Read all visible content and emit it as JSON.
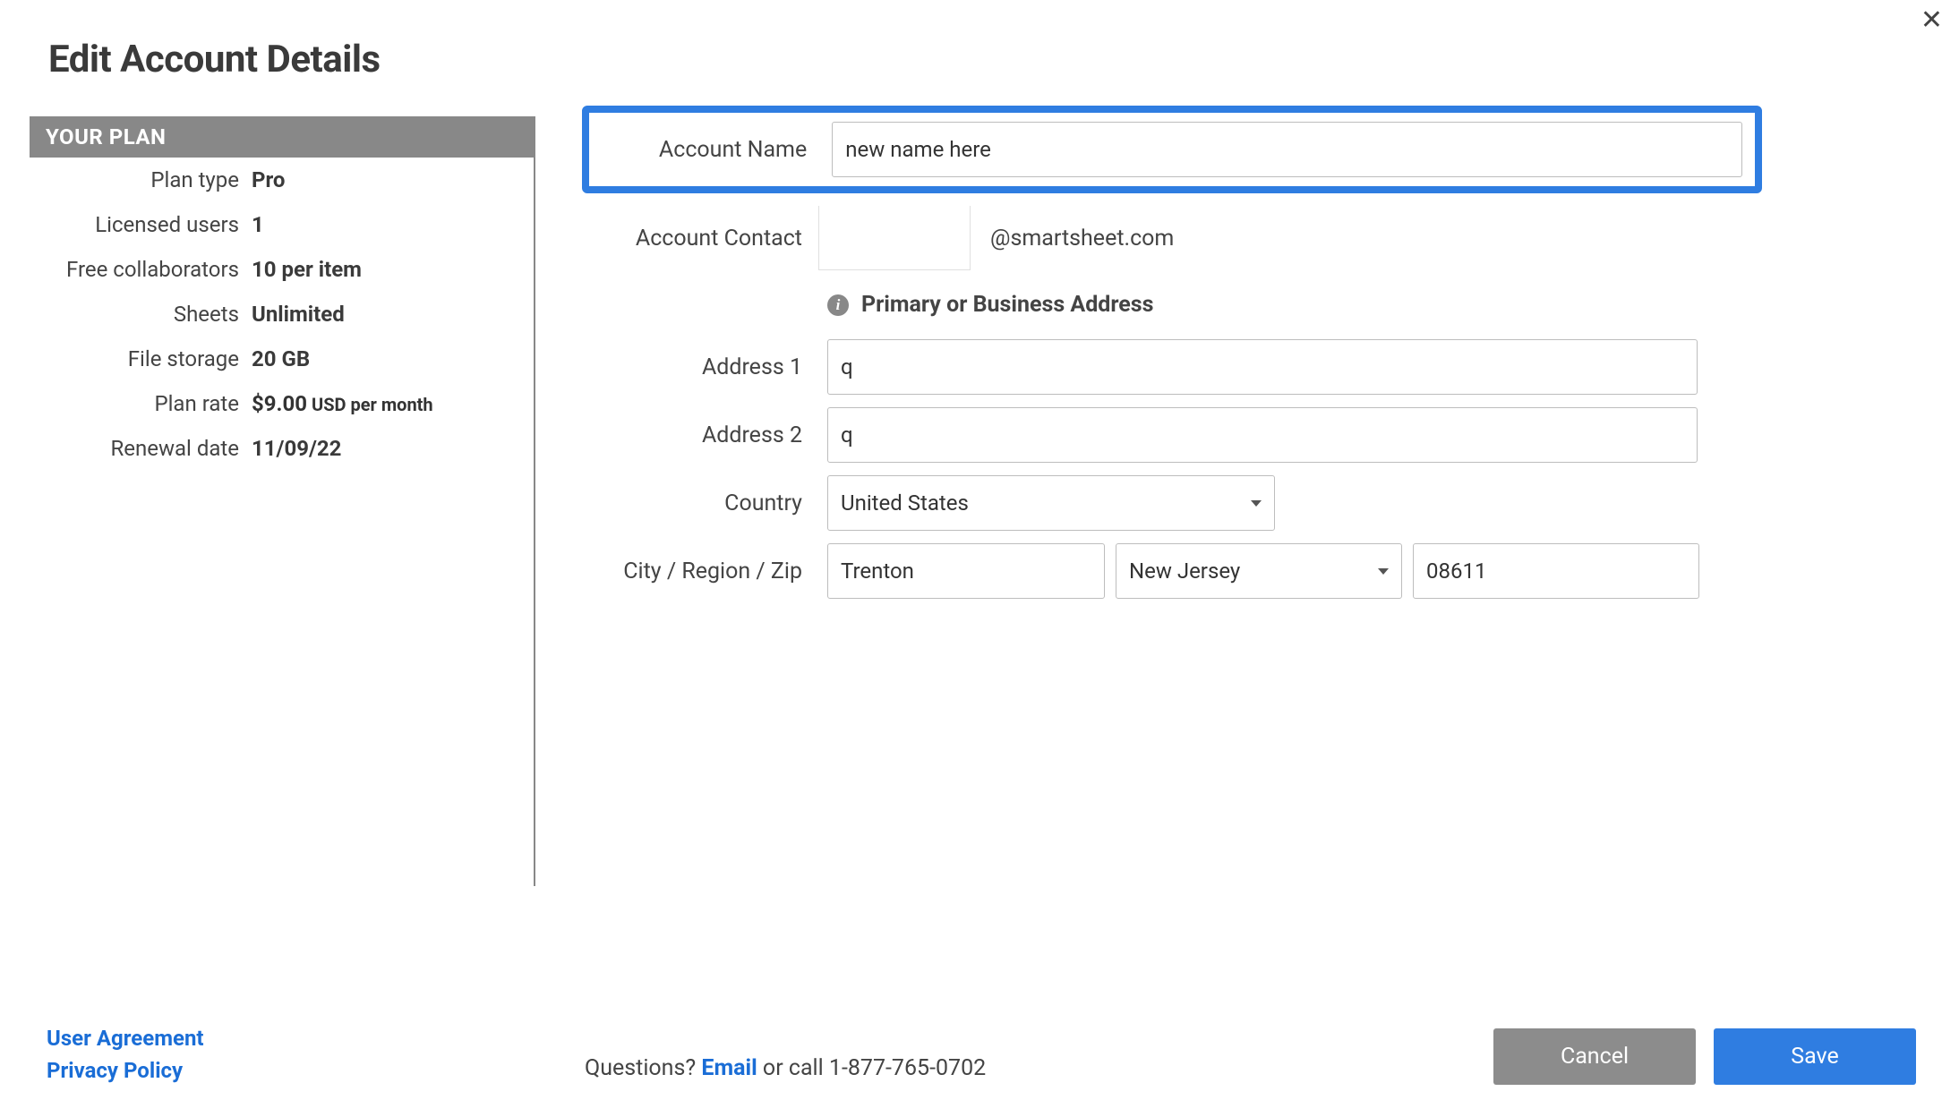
{
  "title": "Edit Account Details",
  "sidebar": {
    "header": "YOUR PLAN",
    "rows": {
      "plan_type": {
        "label": "Plan type",
        "value": "Pro"
      },
      "licensed_users": {
        "label": "Licensed users",
        "value": "1"
      },
      "free_collaborators": {
        "label": "Free collaborators",
        "value": "10 per item"
      },
      "sheets": {
        "label": "Sheets",
        "value": "Unlimited"
      },
      "file_storage": {
        "label": "File storage",
        "value": "20 GB"
      },
      "plan_rate": {
        "label": "Plan rate",
        "amount": "$9.00",
        "unit": " USD per month"
      },
      "renewal_date": {
        "label": "Renewal date",
        "value": "11/09/22"
      }
    }
  },
  "form": {
    "account_name": {
      "label": "Account Name",
      "value": "new name here"
    },
    "account_contact": {
      "label": "Account Contact",
      "value_suffix": "@smartsheet.com"
    },
    "address_heading": "Primary or Business Address",
    "address1": {
      "label": "Address 1",
      "value": "q"
    },
    "address2": {
      "label": "Address 2",
      "value": "q"
    },
    "country": {
      "label": "Country",
      "value": "United States"
    },
    "city_region_zip_label": "City / Region / Zip",
    "city": "Trenton",
    "region": "New Jersey",
    "zip": "08611"
  },
  "footer": {
    "links": {
      "user_agreement": "User Agreement",
      "privacy_policy": "Privacy Policy"
    },
    "questions_prefix": "Questions? ",
    "email_text": "Email",
    "questions_suffix": " or call 1-877-765-0702",
    "cancel": "Cancel",
    "save": "Save"
  }
}
